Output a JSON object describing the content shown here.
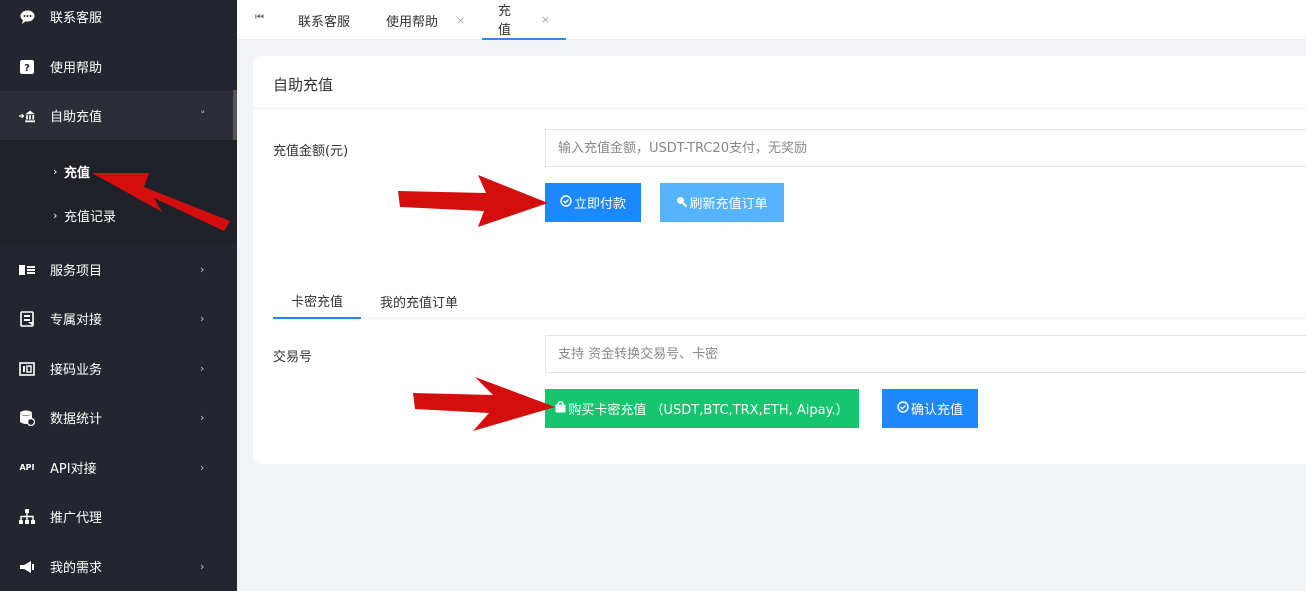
{
  "sidebar": {
    "items": [
      {
        "label": "联系客服",
        "icon": "chat-icon"
      },
      {
        "label": "使用帮助",
        "icon": "help-icon"
      },
      {
        "label": "自助充值",
        "icon": "recharge-icon",
        "chevron": "˅"
      },
      {
        "label": "服务项目",
        "icon": "services-icon",
        "chevron": "›"
      },
      {
        "label": "专属对接",
        "icon": "connect-icon",
        "chevron": "›"
      },
      {
        "label": "接码业务",
        "icon": "code-icon",
        "chevron": "›"
      },
      {
        "label": "数据统计",
        "icon": "database-icon",
        "chevron": "›"
      },
      {
        "label": "API对接",
        "icon": "api-icon",
        "chevron": "›"
      },
      {
        "label": "推广代理",
        "icon": "sitemap-icon"
      },
      {
        "label": "我的需求",
        "icon": "megaphone-icon",
        "chevron": "›"
      }
    ],
    "sub_items": [
      {
        "label": "充值"
      },
      {
        "label": "充值记录"
      }
    ],
    "api_icon_text": "API"
  },
  "tabs": {
    "home_icon": "⏮",
    "items": [
      {
        "label": "联系客服"
      },
      {
        "label": "使用帮助",
        "close": "×"
      },
      {
        "label": "充值",
        "close": "×"
      }
    ]
  },
  "card": {
    "title": "自助充值",
    "amount_label": "充值金额(元)",
    "amount_placeholder": "输入充值金额，USDT-TRC20支付，无奖励",
    "pay_button": "立即付款",
    "refresh_button": "刷新充值订单",
    "subtabs": [
      {
        "label": "卡密充值"
      },
      {
        "label": "我的充值订单"
      }
    ],
    "txn_label": "交易号",
    "txn_placeholder": "支持 资金转换交易号、卡密",
    "buy_card_button": "购买卡密充值 （USDT,BTC,TRX,ETH, Aipay.）",
    "confirm_button": "确认充值"
  },
  "colors": {
    "sidebar_bg": "#23262e",
    "accent_blue": "#1e88ff",
    "light_blue": "#56b4ff",
    "green": "#17c56f",
    "arrow_red": "#d40d0d"
  }
}
